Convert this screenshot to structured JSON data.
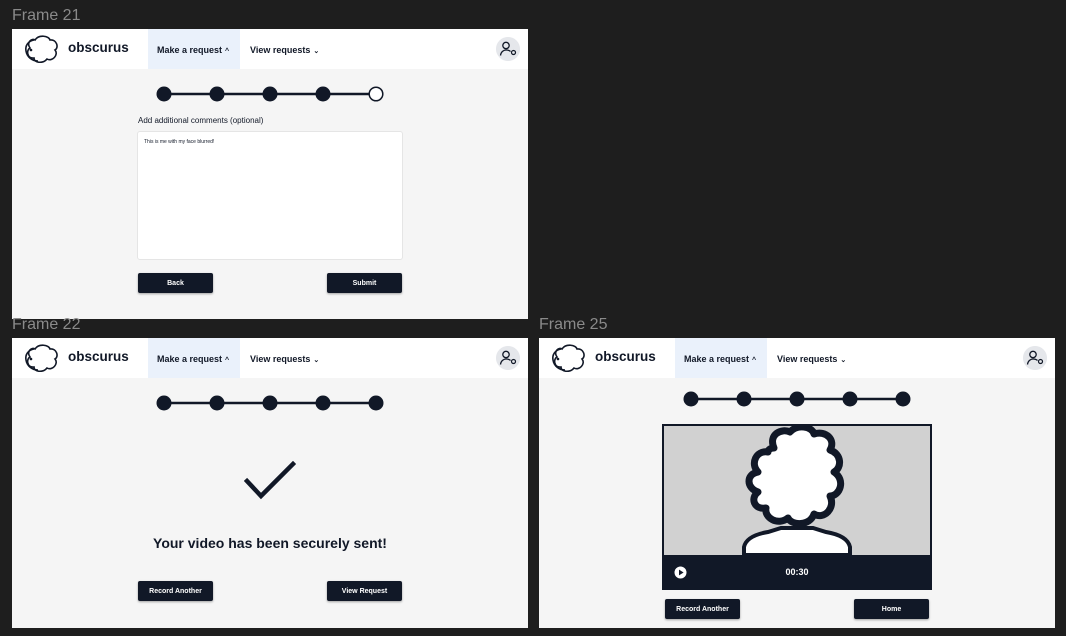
{
  "frames": {
    "f21": {
      "title": "Frame 21",
      "brand": "obscurus",
      "nav": {
        "make_request": "Make a request",
        "view_requests": "View requests"
      },
      "steps": {
        "total": 5,
        "completed": 4
      },
      "comments_label": "Add additional comments (optional)",
      "comments_value": "This is me with my face blurred!",
      "back_label": "Back",
      "submit_label": "Submit"
    },
    "f22": {
      "title": "Frame 22",
      "brand": "obscurus",
      "nav": {
        "make_request": "Make a request",
        "view_requests": "View requests"
      },
      "steps": {
        "total": 5,
        "completed": 5
      },
      "success_message": "Your video has been securely sent!",
      "record_another_label": "Record Another",
      "view_request_label": "View Request"
    },
    "f25": {
      "title": "Frame 25",
      "brand": "obscurus",
      "nav": {
        "make_request": "Make a request",
        "view_requests": "View requests"
      },
      "steps": {
        "total": 5,
        "completed": 5
      },
      "video_time": "00:30",
      "record_another_label": "Record Another",
      "home_label": "Home"
    }
  },
  "icons": {
    "logo": "obscurus-logo",
    "caret_up": "chevron-up-icon",
    "caret_down": "chevron-down-icon",
    "avatar": "user-settings-icon",
    "check": "checkmark-icon",
    "play": "play-icon"
  },
  "colors": {
    "primary": "#111827",
    "nav_active": "#eaf1fb",
    "frame_bg": "#f5f5f5",
    "canvas_bg": "#1e1e1e"
  }
}
